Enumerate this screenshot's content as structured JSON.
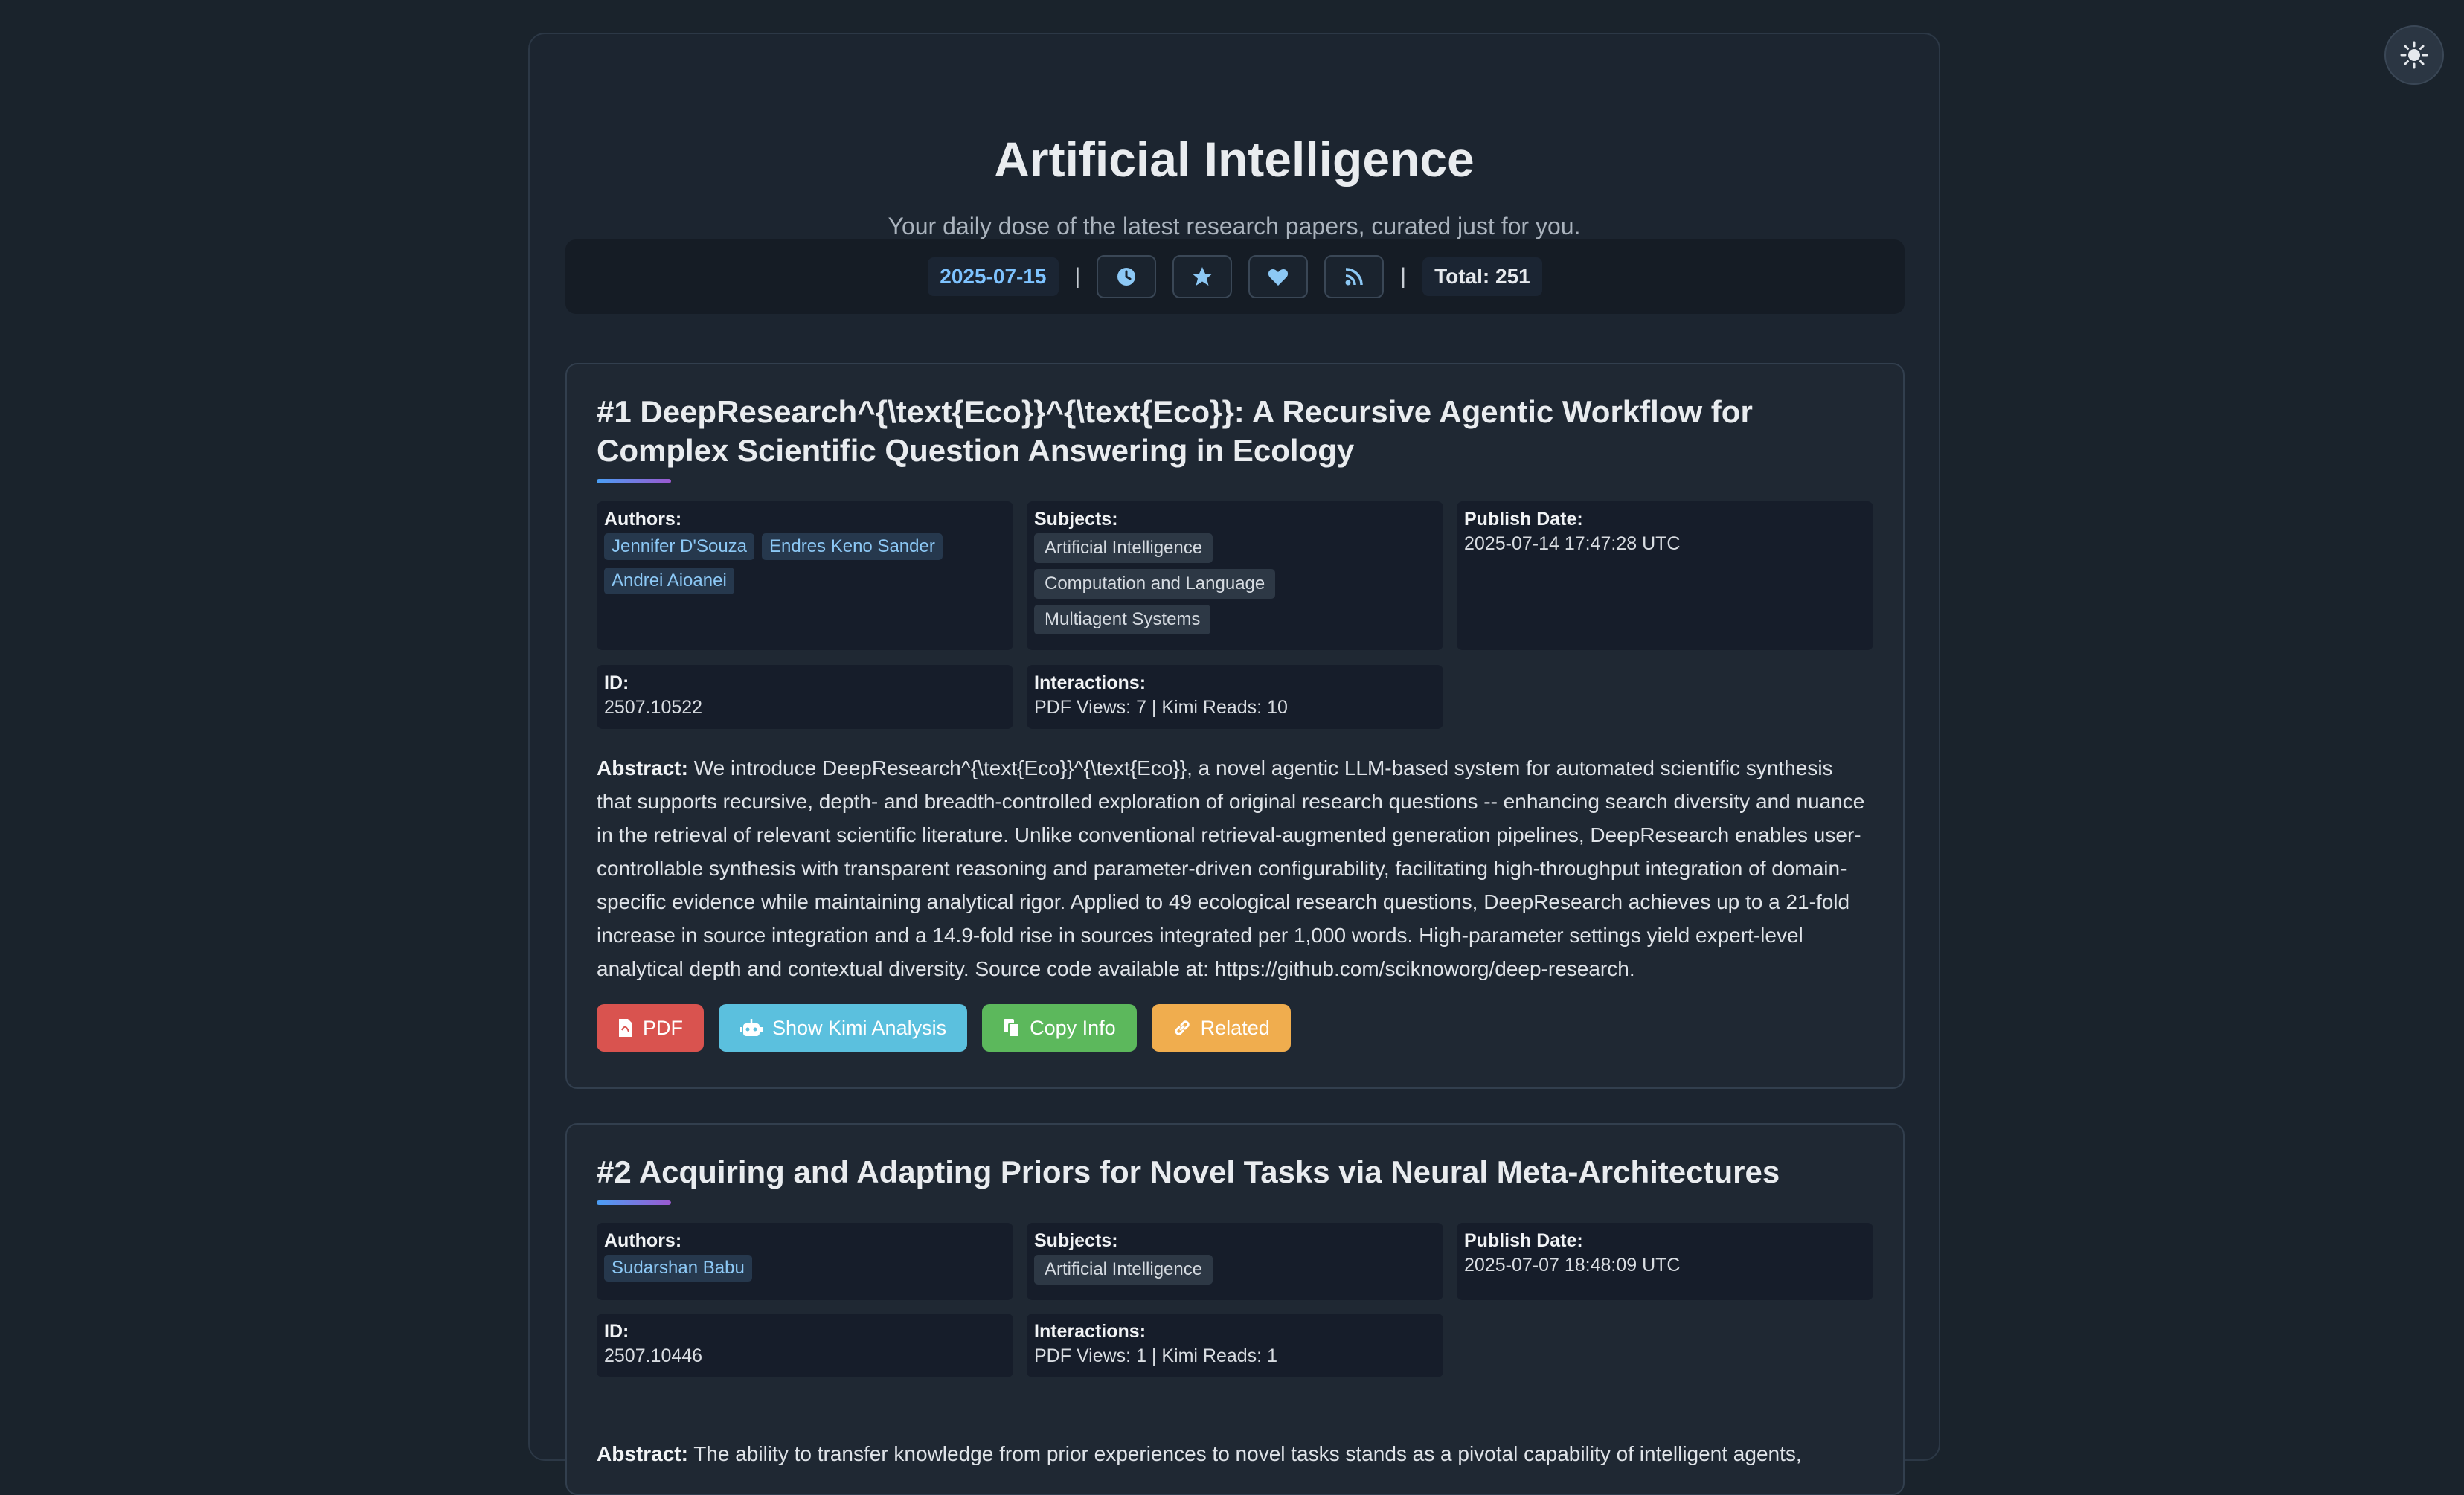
{
  "header": {
    "title": "Artificial Intelligence",
    "tagline": "Your daily dose of the latest research papers, curated just for you."
  },
  "toolbar": {
    "date": "2025-07-15",
    "separator": "|",
    "total": "Total: 251",
    "icons": [
      "clock-icon",
      "star-icon",
      "heart-icon",
      "rss-icon"
    ]
  },
  "theme_toggle_icon": "sun-icon",
  "colors": {
    "background": "#1a232c",
    "accent": "#7ec3ff",
    "pdf": "#d9534f",
    "kimi": "#5bc0de",
    "copy": "#5cb85c",
    "related": "#f0ad4e"
  },
  "labels": {
    "authors": "Authors:",
    "subjects": "Subjects:",
    "publish_date": "Publish Date:",
    "id": "ID:",
    "interactions": "Interactions:",
    "abstract": "Abstract:"
  },
  "buttons": {
    "pdf": "PDF",
    "kimi": "Show Kimi Analysis",
    "copy": "Copy Info",
    "related": "Related"
  },
  "papers": [
    {
      "title": "#1 DeepResearch^{\\text{Eco}}^{\\text{Eco}}: A Recursive Agentic Workflow for Complex Scientific Question Answering in Ecology",
      "authors": [
        "Jennifer D'Souza",
        "Endres Keno Sander",
        "Andrei Aioanei"
      ],
      "subjects": [
        "Artificial Intelligence",
        "Computation and Language",
        "Multiagent Systems"
      ],
      "publish_date": "2025-07-14 17:47:28 UTC",
      "id": "2507.10522",
      "interactions": "PDF Views: 7 | Kimi Reads: 10",
      "abstract": "We introduce DeepResearch^{\\text{Eco}}^{\\text{Eco}}, a novel agentic LLM-based system for automated scientific synthesis that supports recursive, depth- and breadth-controlled exploration of original research questions -- enhancing search diversity and nuance in the retrieval of relevant scientific literature. Unlike conventional retrieval-augmented generation pipelines, DeepResearch enables user-controllable synthesis with transparent reasoning and parameter-driven configurability, facilitating high-throughput integration of domain-specific evidence while maintaining analytical rigor. Applied to 49 ecological research questions, DeepResearch achieves up to a 21-fold increase in source integration and a 14.9-fold rise in sources integrated per 1,000 words. High-parameter settings yield expert-level analytical depth and contextual diversity. Source code available at: https://github.com/sciknoworg/deep-research."
    },
    {
      "title": "#2 Acquiring and Adapting Priors for Novel Tasks via Neural Meta-Architectures",
      "authors": [
        "Sudarshan Babu"
      ],
      "subjects": [
        "Artificial Intelligence"
      ],
      "publish_date": "2025-07-07 18:48:09 UTC",
      "id": "2507.10446",
      "interactions": "PDF Views: 1 | Kimi Reads: 1",
      "abstract": "The ability to transfer knowledge from prior experiences to novel tasks stands as a pivotal capability of intelligent agents,"
    }
  ]
}
